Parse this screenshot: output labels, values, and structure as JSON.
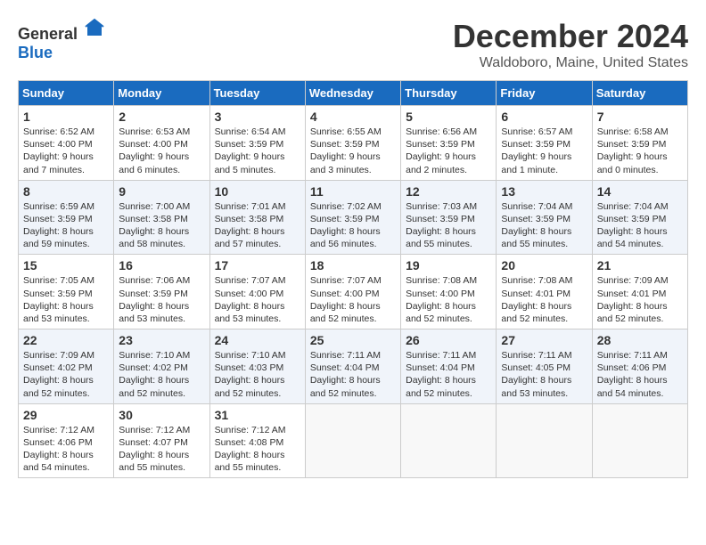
{
  "logo": {
    "general": "General",
    "blue": "Blue"
  },
  "title": {
    "month_year": "December 2024",
    "location": "Waldoboro, Maine, United States"
  },
  "days_of_week": [
    "Sunday",
    "Monday",
    "Tuesday",
    "Wednesday",
    "Thursday",
    "Friday",
    "Saturday"
  ],
  "weeks": [
    [
      {
        "day": 1,
        "sunrise": "6:52 AM",
        "sunset": "4:00 PM",
        "daylight": "9 hours and 7 minutes."
      },
      {
        "day": 2,
        "sunrise": "6:53 AM",
        "sunset": "4:00 PM",
        "daylight": "9 hours and 6 minutes."
      },
      {
        "day": 3,
        "sunrise": "6:54 AM",
        "sunset": "3:59 PM",
        "daylight": "9 hours and 5 minutes."
      },
      {
        "day": 4,
        "sunrise": "6:55 AM",
        "sunset": "3:59 PM",
        "daylight": "9 hours and 3 minutes."
      },
      {
        "day": 5,
        "sunrise": "6:56 AM",
        "sunset": "3:59 PM",
        "daylight": "9 hours and 2 minutes."
      },
      {
        "day": 6,
        "sunrise": "6:57 AM",
        "sunset": "3:59 PM",
        "daylight": "9 hours and 1 minute."
      },
      {
        "day": 7,
        "sunrise": "6:58 AM",
        "sunset": "3:59 PM",
        "daylight": "9 hours and 0 minutes."
      }
    ],
    [
      {
        "day": 8,
        "sunrise": "6:59 AM",
        "sunset": "3:59 PM",
        "daylight": "8 hours and 59 minutes."
      },
      {
        "day": 9,
        "sunrise": "7:00 AM",
        "sunset": "3:58 PM",
        "daylight": "8 hours and 58 minutes."
      },
      {
        "day": 10,
        "sunrise": "7:01 AM",
        "sunset": "3:58 PM",
        "daylight": "8 hours and 57 minutes."
      },
      {
        "day": 11,
        "sunrise": "7:02 AM",
        "sunset": "3:59 PM",
        "daylight": "8 hours and 56 minutes."
      },
      {
        "day": 12,
        "sunrise": "7:03 AM",
        "sunset": "3:59 PM",
        "daylight": "8 hours and 55 minutes."
      },
      {
        "day": 13,
        "sunrise": "7:04 AM",
        "sunset": "3:59 PM",
        "daylight": "8 hours and 55 minutes."
      },
      {
        "day": 14,
        "sunrise": "7:04 AM",
        "sunset": "3:59 PM",
        "daylight": "8 hours and 54 minutes."
      }
    ],
    [
      {
        "day": 15,
        "sunrise": "7:05 AM",
        "sunset": "3:59 PM",
        "daylight": "8 hours and 53 minutes."
      },
      {
        "day": 16,
        "sunrise": "7:06 AM",
        "sunset": "3:59 PM",
        "daylight": "8 hours and 53 minutes."
      },
      {
        "day": 17,
        "sunrise": "7:07 AM",
        "sunset": "4:00 PM",
        "daylight": "8 hours and 53 minutes."
      },
      {
        "day": 18,
        "sunrise": "7:07 AM",
        "sunset": "4:00 PM",
        "daylight": "8 hours and 52 minutes."
      },
      {
        "day": 19,
        "sunrise": "7:08 AM",
        "sunset": "4:00 PM",
        "daylight": "8 hours and 52 minutes."
      },
      {
        "day": 20,
        "sunrise": "7:08 AM",
        "sunset": "4:01 PM",
        "daylight": "8 hours and 52 minutes."
      },
      {
        "day": 21,
        "sunrise": "7:09 AM",
        "sunset": "4:01 PM",
        "daylight": "8 hours and 52 minutes."
      }
    ],
    [
      {
        "day": 22,
        "sunrise": "7:09 AM",
        "sunset": "4:02 PM",
        "daylight": "8 hours and 52 minutes."
      },
      {
        "day": 23,
        "sunrise": "7:10 AM",
        "sunset": "4:02 PM",
        "daylight": "8 hours and 52 minutes."
      },
      {
        "day": 24,
        "sunrise": "7:10 AM",
        "sunset": "4:03 PM",
        "daylight": "8 hours and 52 minutes."
      },
      {
        "day": 25,
        "sunrise": "7:11 AM",
        "sunset": "4:04 PM",
        "daylight": "8 hours and 52 minutes."
      },
      {
        "day": 26,
        "sunrise": "7:11 AM",
        "sunset": "4:04 PM",
        "daylight": "8 hours and 52 minutes."
      },
      {
        "day": 27,
        "sunrise": "7:11 AM",
        "sunset": "4:05 PM",
        "daylight": "8 hours and 53 minutes."
      },
      {
        "day": 28,
        "sunrise": "7:11 AM",
        "sunset": "4:06 PM",
        "daylight": "8 hours and 54 minutes."
      }
    ],
    [
      {
        "day": 29,
        "sunrise": "7:12 AM",
        "sunset": "4:06 PM",
        "daylight": "8 hours and 54 minutes."
      },
      {
        "day": 30,
        "sunrise": "7:12 AM",
        "sunset": "4:07 PM",
        "daylight": "8 hours and 55 minutes."
      },
      {
        "day": 31,
        "sunrise": "7:12 AM",
        "sunset": "4:08 PM",
        "daylight": "8 hours and 55 minutes."
      },
      null,
      null,
      null,
      null
    ]
  ]
}
